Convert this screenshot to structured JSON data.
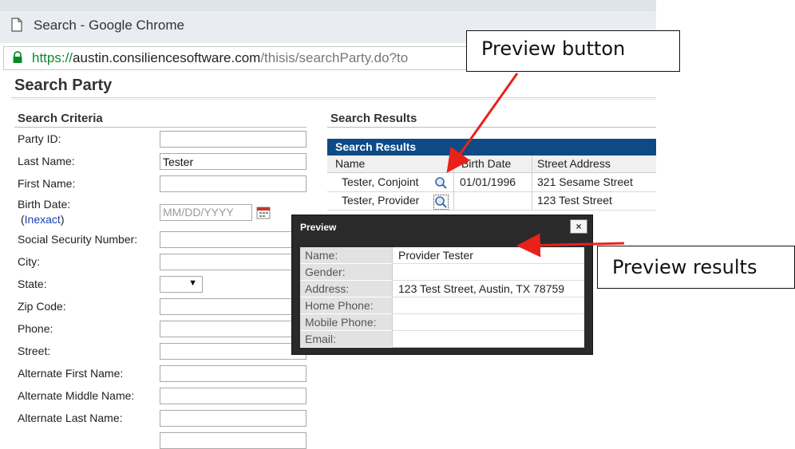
{
  "browser": {
    "window_title": "Search - Google Chrome",
    "url_protocol": "https://",
    "url_host": "austin.consiliencesoftware.com",
    "url_path": "/thisis/searchParty.do?to"
  },
  "page": {
    "title": "Search Party"
  },
  "criteria": {
    "header": "Search Criteria",
    "fields": {
      "party_id": {
        "label": "Party ID:",
        "value": ""
      },
      "last_name": {
        "label": "Last Name:",
        "value": "Tester"
      },
      "first_name": {
        "label": "First Name:",
        "value": ""
      },
      "birth_date": {
        "label": "Birth Date:",
        "placeholder": "MM/DD/YYYY",
        "inexact_open": "(",
        "inexact_link": "Inexact",
        "inexact_close": ")"
      },
      "ssn": {
        "label": "Social Security Number:",
        "value": ""
      },
      "city": {
        "label": "City:",
        "value": ""
      },
      "state": {
        "label": "State:",
        "value": ""
      },
      "zip": {
        "label": "Zip Code:",
        "value": ""
      },
      "phone": {
        "label": "Phone:",
        "value": ""
      },
      "street": {
        "label": "Street:",
        "value": ""
      },
      "alt_first": {
        "label": "Alternate First Name:",
        "value": ""
      },
      "alt_middle": {
        "label": "Alternate Middle Name:",
        "value": ""
      },
      "alt_last": {
        "label": "Alternate Last Name:",
        "value": ""
      }
    }
  },
  "results": {
    "section_header": "Search Results",
    "grid_title": "Search Results",
    "columns": [
      "Name",
      "Birth Date",
      "Street Address"
    ],
    "rows": [
      {
        "name": "Tester, Conjoint",
        "birth_date": "01/01/1996",
        "street": "321 Sesame Street"
      },
      {
        "name": "Tester, Provider",
        "birth_date": "",
        "street": "123 Test Street"
      }
    ]
  },
  "preview": {
    "title": "Preview",
    "close_label": "×",
    "rows": [
      {
        "label": "Name:",
        "value": "Provider Tester"
      },
      {
        "label": "Gender:",
        "value": ""
      },
      {
        "label": "Address:",
        "value": "123 Test Street, Austin, TX 78759"
      },
      {
        "label": "Home Phone:",
        "value": ""
      },
      {
        "label": "Mobile Phone:",
        "value": ""
      },
      {
        "label": "Email:",
        "value": ""
      }
    ]
  },
  "annotations": {
    "preview_button": "Preview button",
    "preview_results": "Preview results",
    "arrow_color": "#e8221b"
  }
}
